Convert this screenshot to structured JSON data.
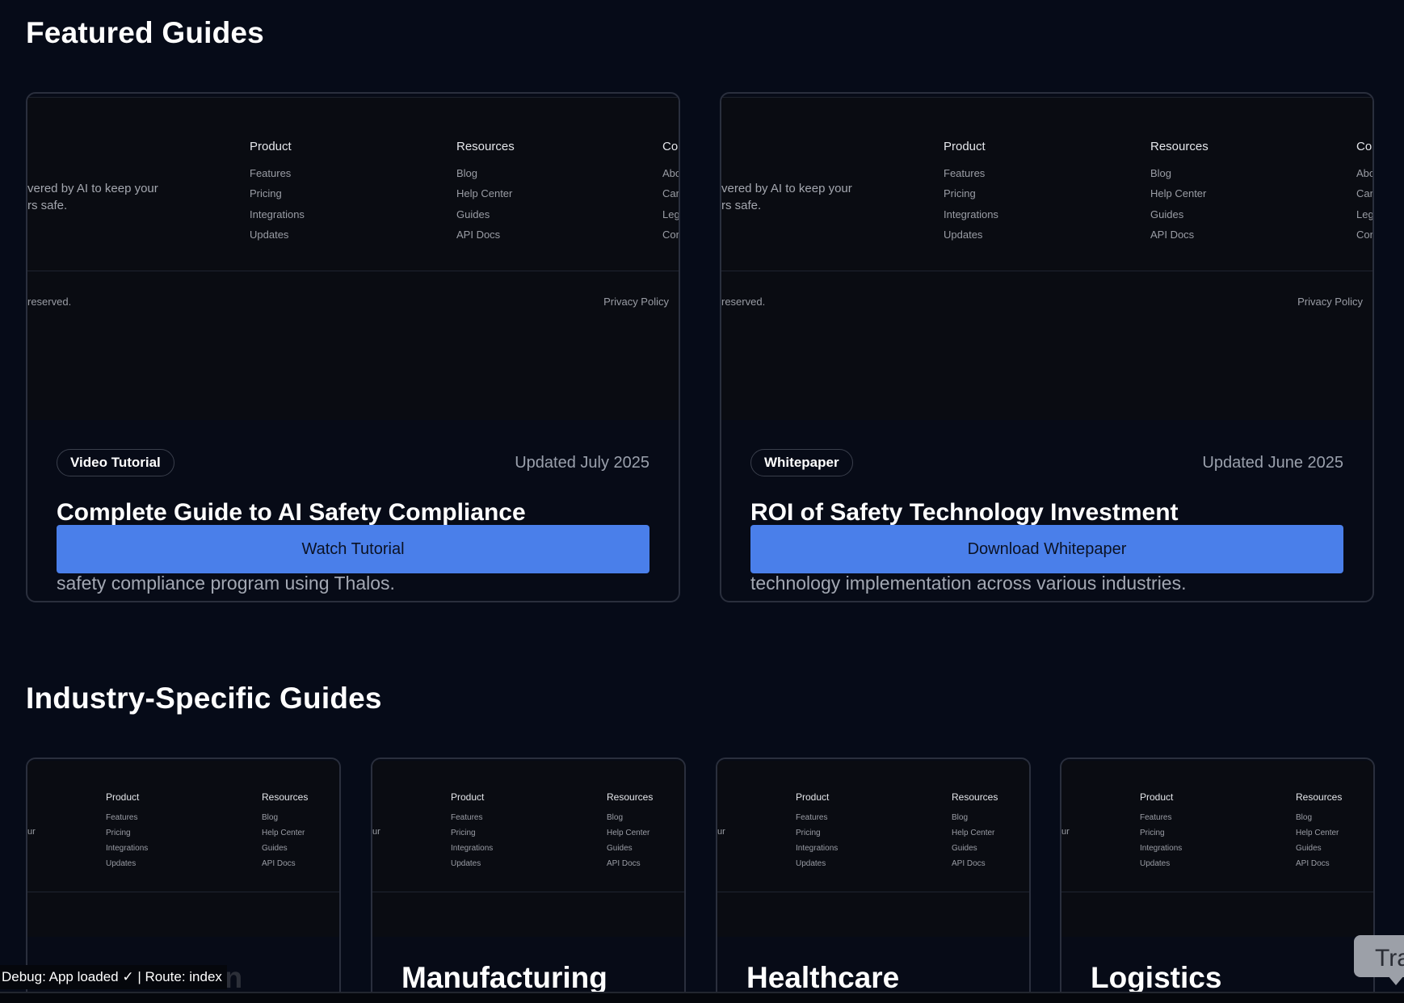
{
  "featured": {
    "title": "Featured Guides",
    "cards": [
      {
        "badge": "Video Tutorial",
        "updated": "Updated July 2025",
        "title": "Complete Guide to AI Safety Compliance",
        "description": "A comprehensive walkthrough of how to implement an AI-powered safety compliance program using Thalos.",
        "button": "Watch Tutorial"
      },
      {
        "badge": "Whitepaper",
        "updated": "Updated June 2025",
        "title": "ROI of Safety Technology Investment",
        "description": "Research-backed analysis of the return on investment for safety technology implementation across various industries.",
        "button": "Download Whitepaper"
      }
    ]
  },
  "thumbnail": {
    "tagline_line1": "vered by AI to keep your",
    "tagline_line2": "rs safe.",
    "tagline_fragment": "ur",
    "columns": [
      {
        "heading": "Product",
        "items": [
          "Features",
          "Pricing",
          "Integrations",
          "Updates"
        ]
      },
      {
        "heading": "Resources",
        "items": [
          "Blog",
          "Help Center",
          "Guides",
          "API Docs"
        ]
      },
      {
        "heading": "Co",
        "items": [
          "Abo",
          "Car",
          "Leg",
          "Cor"
        ]
      }
    ],
    "copyright": "reserved.",
    "privacy": "Privacy Policy"
  },
  "industry": {
    "title": "Industry-Specific Guides",
    "cards": [
      {
        "title": "Construction"
      },
      {
        "title": "Manufacturing"
      },
      {
        "title": "Healthcare"
      },
      {
        "title": "Logistics"
      }
    ]
  },
  "debug": {
    "text": "Debug: App loaded ✓ | Route: index"
  },
  "floating_button": {
    "label": "Tra"
  }
}
